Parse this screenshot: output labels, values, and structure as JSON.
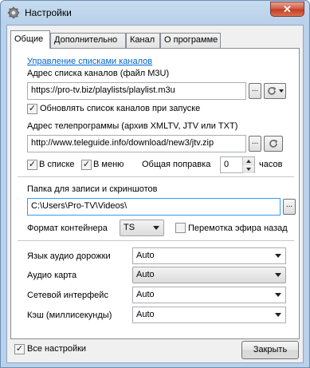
{
  "window": {
    "title": "Настройки",
    "close_glyph": "✕"
  },
  "tabs": [
    {
      "label": "Общие",
      "active": true
    },
    {
      "label": "Дополнительно",
      "active": false
    },
    {
      "label": "Канал",
      "active": false
    },
    {
      "label": "О программе",
      "active": false
    }
  ],
  "general": {
    "manage_channels_link": "Управление списками каналов",
    "playlist_label": "Адрес списка каналов (файл M3U)",
    "playlist_value": "https://pro-tv.biz/playlists/playlist.m3u",
    "update_on_start_label": "Обновлять список каналов при запуске",
    "update_on_start_checked": true,
    "epg_label": "Адрес телепрограммы (архив XMLTV, JTV или TXT)",
    "epg_value": "http://www.teleguide.info/download/new3/jtv.zip",
    "in_list_label": "В списке",
    "in_list_checked": true,
    "in_menu_label": "В меню",
    "in_menu_checked": true,
    "offset_label": "Общая поправка",
    "offset_value": "0",
    "offset_unit": "часов",
    "record_folder_label": "Папка для записи и скриншотов",
    "record_folder_value": "C:\\Users\\Pro-TV\\Videos\\",
    "container_label": "Формат контейнера",
    "container_value": "TS",
    "rewind_label": "Перемотка эфира назад",
    "rewind_checked": false,
    "audio_track_label": "Язык аудио дорожки",
    "audio_track_value": "Auto",
    "audio_card_label": "Аудио карта",
    "audio_card_value": "Auto",
    "network_label": "Сетевой интерфейс",
    "network_value": "Auto",
    "cache_label": "Кэш (миллисекунды)",
    "cache_value": "Auto"
  },
  "footer": {
    "all_settings_label": "Все настройки",
    "all_settings_checked": true,
    "close_button": "Закрыть"
  },
  "ui": {
    "browse_glyph": "...",
    "check_glyph": "✓"
  }
}
